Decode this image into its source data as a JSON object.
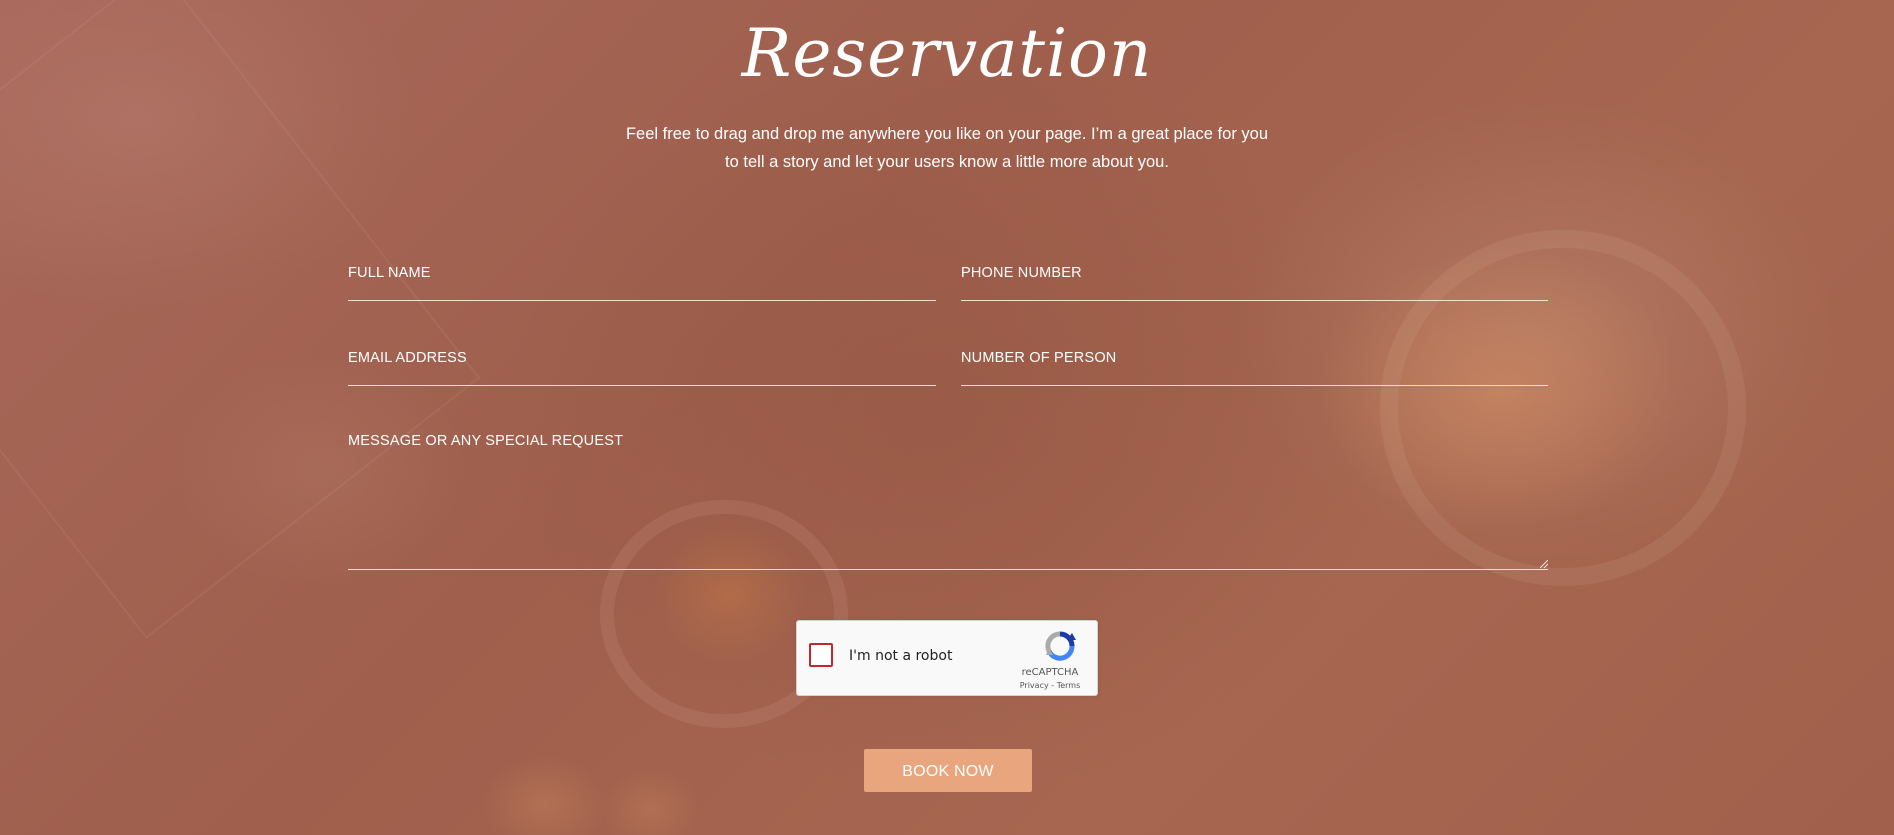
{
  "page": {
    "title": "Reservation",
    "intro_line1": "Feel free to drag and drop me anywhere you like on your page. I’m a great place for you",
    "intro_line2": "to tell a story and let your users know a little more about you."
  },
  "form": {
    "full_name_label": "FULL NAME",
    "phone_label": "PHONE NUMBER",
    "email_label": "EMAIL ADDRESS",
    "persons_label": "NUMBER OF PERSON",
    "message_label": "MESSAGE OR ANY SPECIAL REQUEST",
    "submit_label": "BOOK NOW"
  },
  "captcha": {
    "label": "I'm not a robot",
    "brand": "reCAPTCHA",
    "privacy": "Privacy",
    "separator": " - ",
    "terms": "Terms",
    "checkbox_color": "#c1272d",
    "logo_icon": "recaptcha-logo-icon"
  },
  "colors": {
    "background": "#a3644e",
    "button": "#e9a67e",
    "text": "#ffffff"
  }
}
